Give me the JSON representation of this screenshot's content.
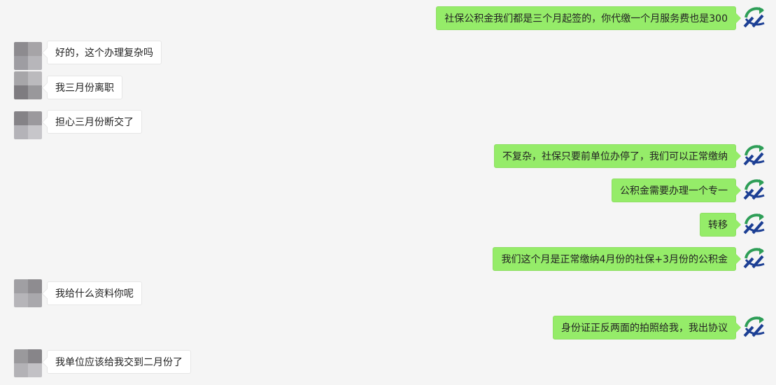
{
  "colors": {
    "background": "#f5f5f5",
    "outgoing_bubble": "#95ec69",
    "incoming_bubble": "#ffffff",
    "avatar_green": "#2e9e57",
    "avatar_blue": "#1c3f94"
  },
  "messages": [
    {
      "side": "out",
      "text": "社保公积金我们都是三个月起签的，你代缴一个月服务费也是300"
    },
    {
      "side": "in",
      "text": "好的，这个办理复杂吗"
    },
    {
      "side": "in",
      "text": "我三月份离职"
    },
    {
      "side": "in",
      "text": "担心三月份断交了"
    },
    {
      "side": "out",
      "text": "不复杂，社保只要前单位办停了，我们可以正常缴纳"
    },
    {
      "side": "out",
      "text": "公积金需要办理一个专一"
    },
    {
      "side": "out",
      "text": "转移"
    },
    {
      "side": "out",
      "text": "我们这个月是正常缴纳4月份的社保+3月份的公积金"
    },
    {
      "side": "in",
      "text": "我给什么资料你呢"
    },
    {
      "side": "out",
      "text": "身份证正反两面的拍照给我，我出协议"
    },
    {
      "side": "in",
      "text": "我单位应该给我交到二月份了"
    }
  ]
}
